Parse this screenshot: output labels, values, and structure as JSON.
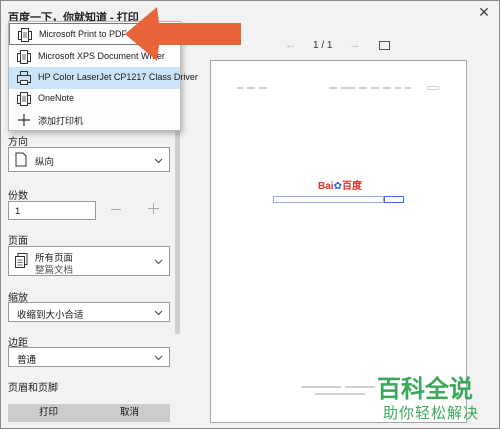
{
  "window": {
    "title": "百度一下，你就知道 - 打印",
    "close_glyph": "✕"
  },
  "printer_menu": {
    "items": [
      {
        "label": "Microsoft Print to PDF",
        "icon": "printer-doc-icon"
      },
      {
        "label": "Microsoft XPS Document Writer",
        "icon": "printer-doc-icon"
      },
      {
        "label": "HP Color LaserJet CP1217 Class Driver",
        "icon": "printer-icon"
      },
      {
        "label": "OneNote",
        "icon": "printer-doc-icon"
      },
      {
        "label": "添加打印机",
        "icon": "plus-icon"
      }
    ],
    "selected_index": 2
  },
  "settings": {
    "orientation_label": "方向",
    "orientation_value": "纵向",
    "copies_label": "份数",
    "copies_value": "1",
    "pages_label": "页面",
    "pages_value": "所有页面",
    "pages_subvalue": "整篇文档",
    "scale_label": "缩放",
    "scale_value": "收缩到大小合适",
    "margins_label": "边距",
    "margins_value": "普通",
    "header_footer_label": "页眉和页脚"
  },
  "buttons": {
    "print": "打印",
    "cancel": "取消"
  },
  "pager": {
    "text": "1 / 1",
    "prev_glyph": "←",
    "next_glyph": "→"
  },
  "preview": {
    "logo_bai": "Bai",
    "logo_du": "百度"
  },
  "watermark": {
    "main": "百科全说",
    "sub": "助你轻松解决"
  },
  "colors": {
    "arrow": "#e8643a",
    "selected_bg": "#cce4f7",
    "watermark": "#3aa85a",
    "button_bg": "#cccccc"
  }
}
